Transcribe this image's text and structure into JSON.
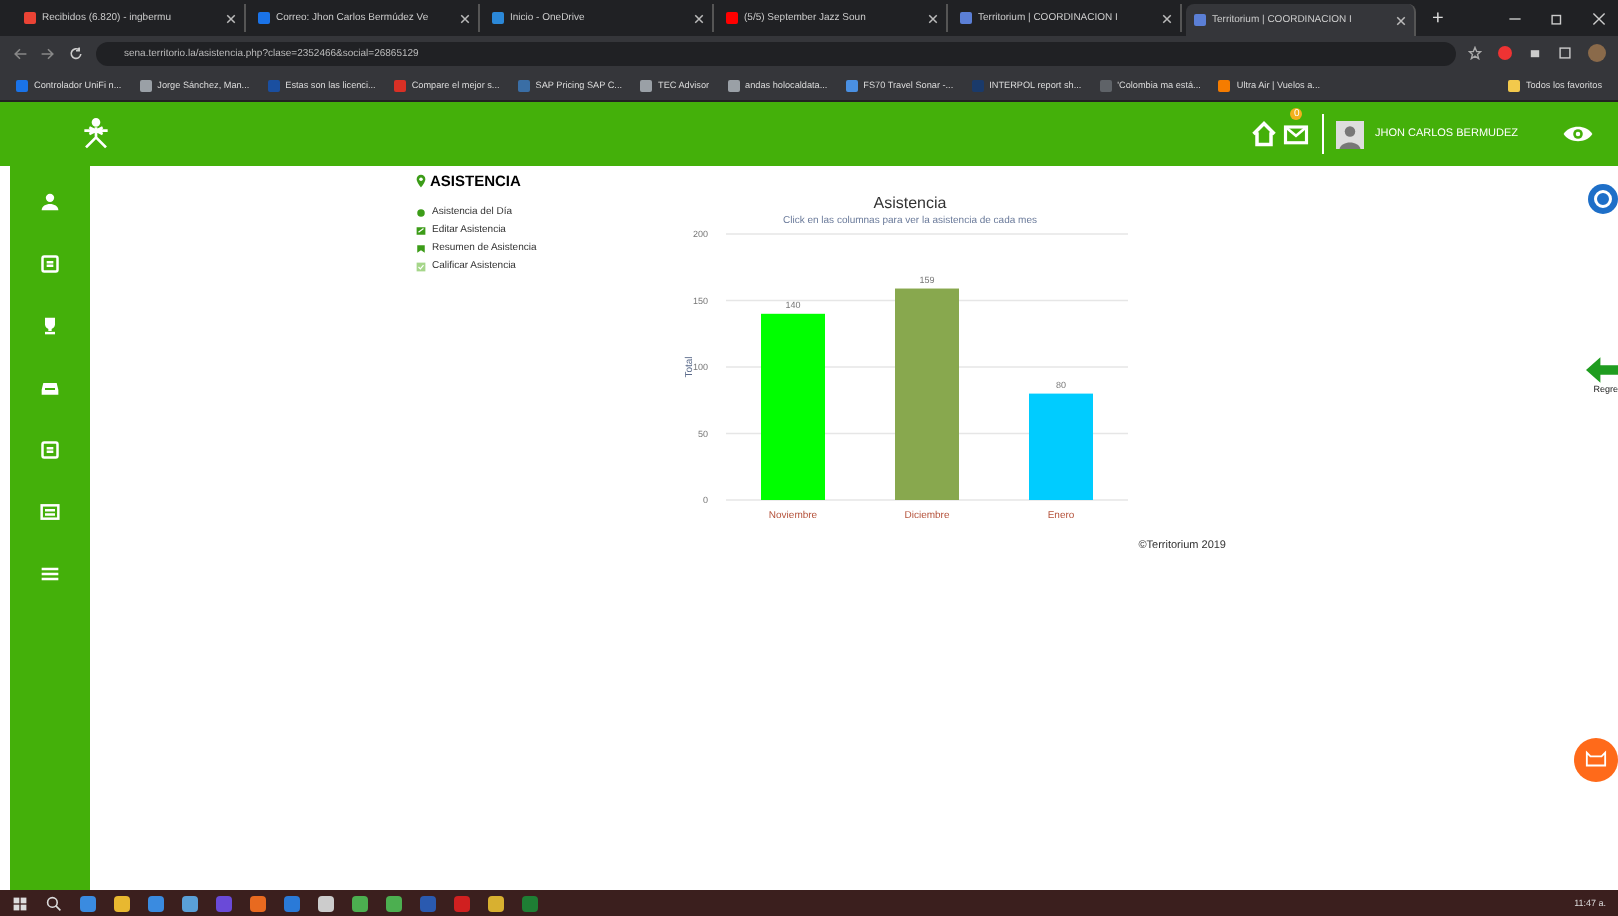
{
  "browser": {
    "tabs": [
      {
        "label": "Recibidos (6.820) - ingbermu",
        "selected": false,
        "color": "#ea4335"
      },
      {
        "label": "Correo: Jhon Carlos Bermúdez Ve",
        "selected": false,
        "color": "#1a73e8"
      },
      {
        "label": "Inicio - OneDrive",
        "selected": false,
        "color": "#2b88d8"
      },
      {
        "label": "(5/5) September Jazz Soun",
        "selected": false,
        "color": "#ff0000"
      },
      {
        "label": "Territorium | COORDINACION I",
        "selected": false,
        "color": "#5b7fd6"
      },
      {
        "label": "Territorium | COORDINACION I",
        "selected": true,
        "color": "#5b7fd6"
      }
    ],
    "new_tab": "+",
    "address": "sena.territorio.la/asistencia.php?clase=2352466&social=26865129",
    "bookmarks": [
      {
        "label": "Controlador UniFi n...",
        "color": "#1a73e8"
      },
      {
        "label": "Jorge Sánchez, Man...",
        "color": "#9aa0a6"
      },
      {
        "label": "Estas son las licenci...",
        "color": "#1a4fa0"
      },
      {
        "label": "Compare el mejor s...",
        "color": "#d93025"
      },
      {
        "label": "SAP Pricing SAP C...",
        "color": "#3a6ea5"
      },
      {
        "label": "TEC Advisor",
        "color": "#9aa0a6"
      },
      {
        "label": "andas holocaldata...",
        "color": "#9aa0a6"
      },
      {
        "label": "FS70 Travel Sonar -...",
        "color": "#4a90e2"
      },
      {
        "label": "INTERPOL report sh...",
        "color": "#1a3a6a"
      },
      {
        "label": "'Colombia ma está...",
        "color": "#5f6368"
      },
      {
        "label": "Ultra Air | Vuelos a...",
        "color": "#f57c00"
      }
    ],
    "all_bookmarks": "Todos los favoritos"
  },
  "header": {
    "mail_badge": "0",
    "user_name": "JHON CARLOS BERMUDEZ"
  },
  "sidebar": {
    "items": [
      {
        "kind": "user"
      },
      {
        "kind": "card"
      },
      {
        "kind": "trophy"
      },
      {
        "kind": "inbox"
      },
      {
        "kind": "card"
      },
      {
        "kind": "list"
      },
      {
        "kind": "menu"
      }
    ]
  },
  "menu": {
    "title": "ASISTENCIA",
    "items": [
      {
        "label": "Asistencia del Día",
        "kind": "dot"
      },
      {
        "label": "Editar Asistencia",
        "kind": "edit"
      },
      {
        "label": "Resumen de Asistencia",
        "kind": "summary"
      },
      {
        "label": "Calificar Asistencia",
        "kind": "check"
      }
    ]
  },
  "chart": {
    "chart_data": {
      "type": "bar",
      "title": "Asistencia",
      "ylabel": "Total",
      "categories": [
        "Noviembre",
        "Diciembre",
        "Enero"
      ],
      "series": [
        {
          "values": [
            140,
            159,
            80
          ]
        }
      ],
      "colors": [
        "#00ff00",
        "#88a84e",
        "#00ccff"
      ],
      "ylim": [
        0,
        200
      ],
      "grid": true,
      "yticks": [
        0,
        50,
        100,
        150,
        200
      ],
      "data_labels": true
    },
    "subtitle": "Click en las columnas para ver la asistencia de cada mes"
  },
  "footer": "©Territorium 2019",
  "back_label": "Regre",
  "taskbar": {
    "time": "11:47 a."
  }
}
